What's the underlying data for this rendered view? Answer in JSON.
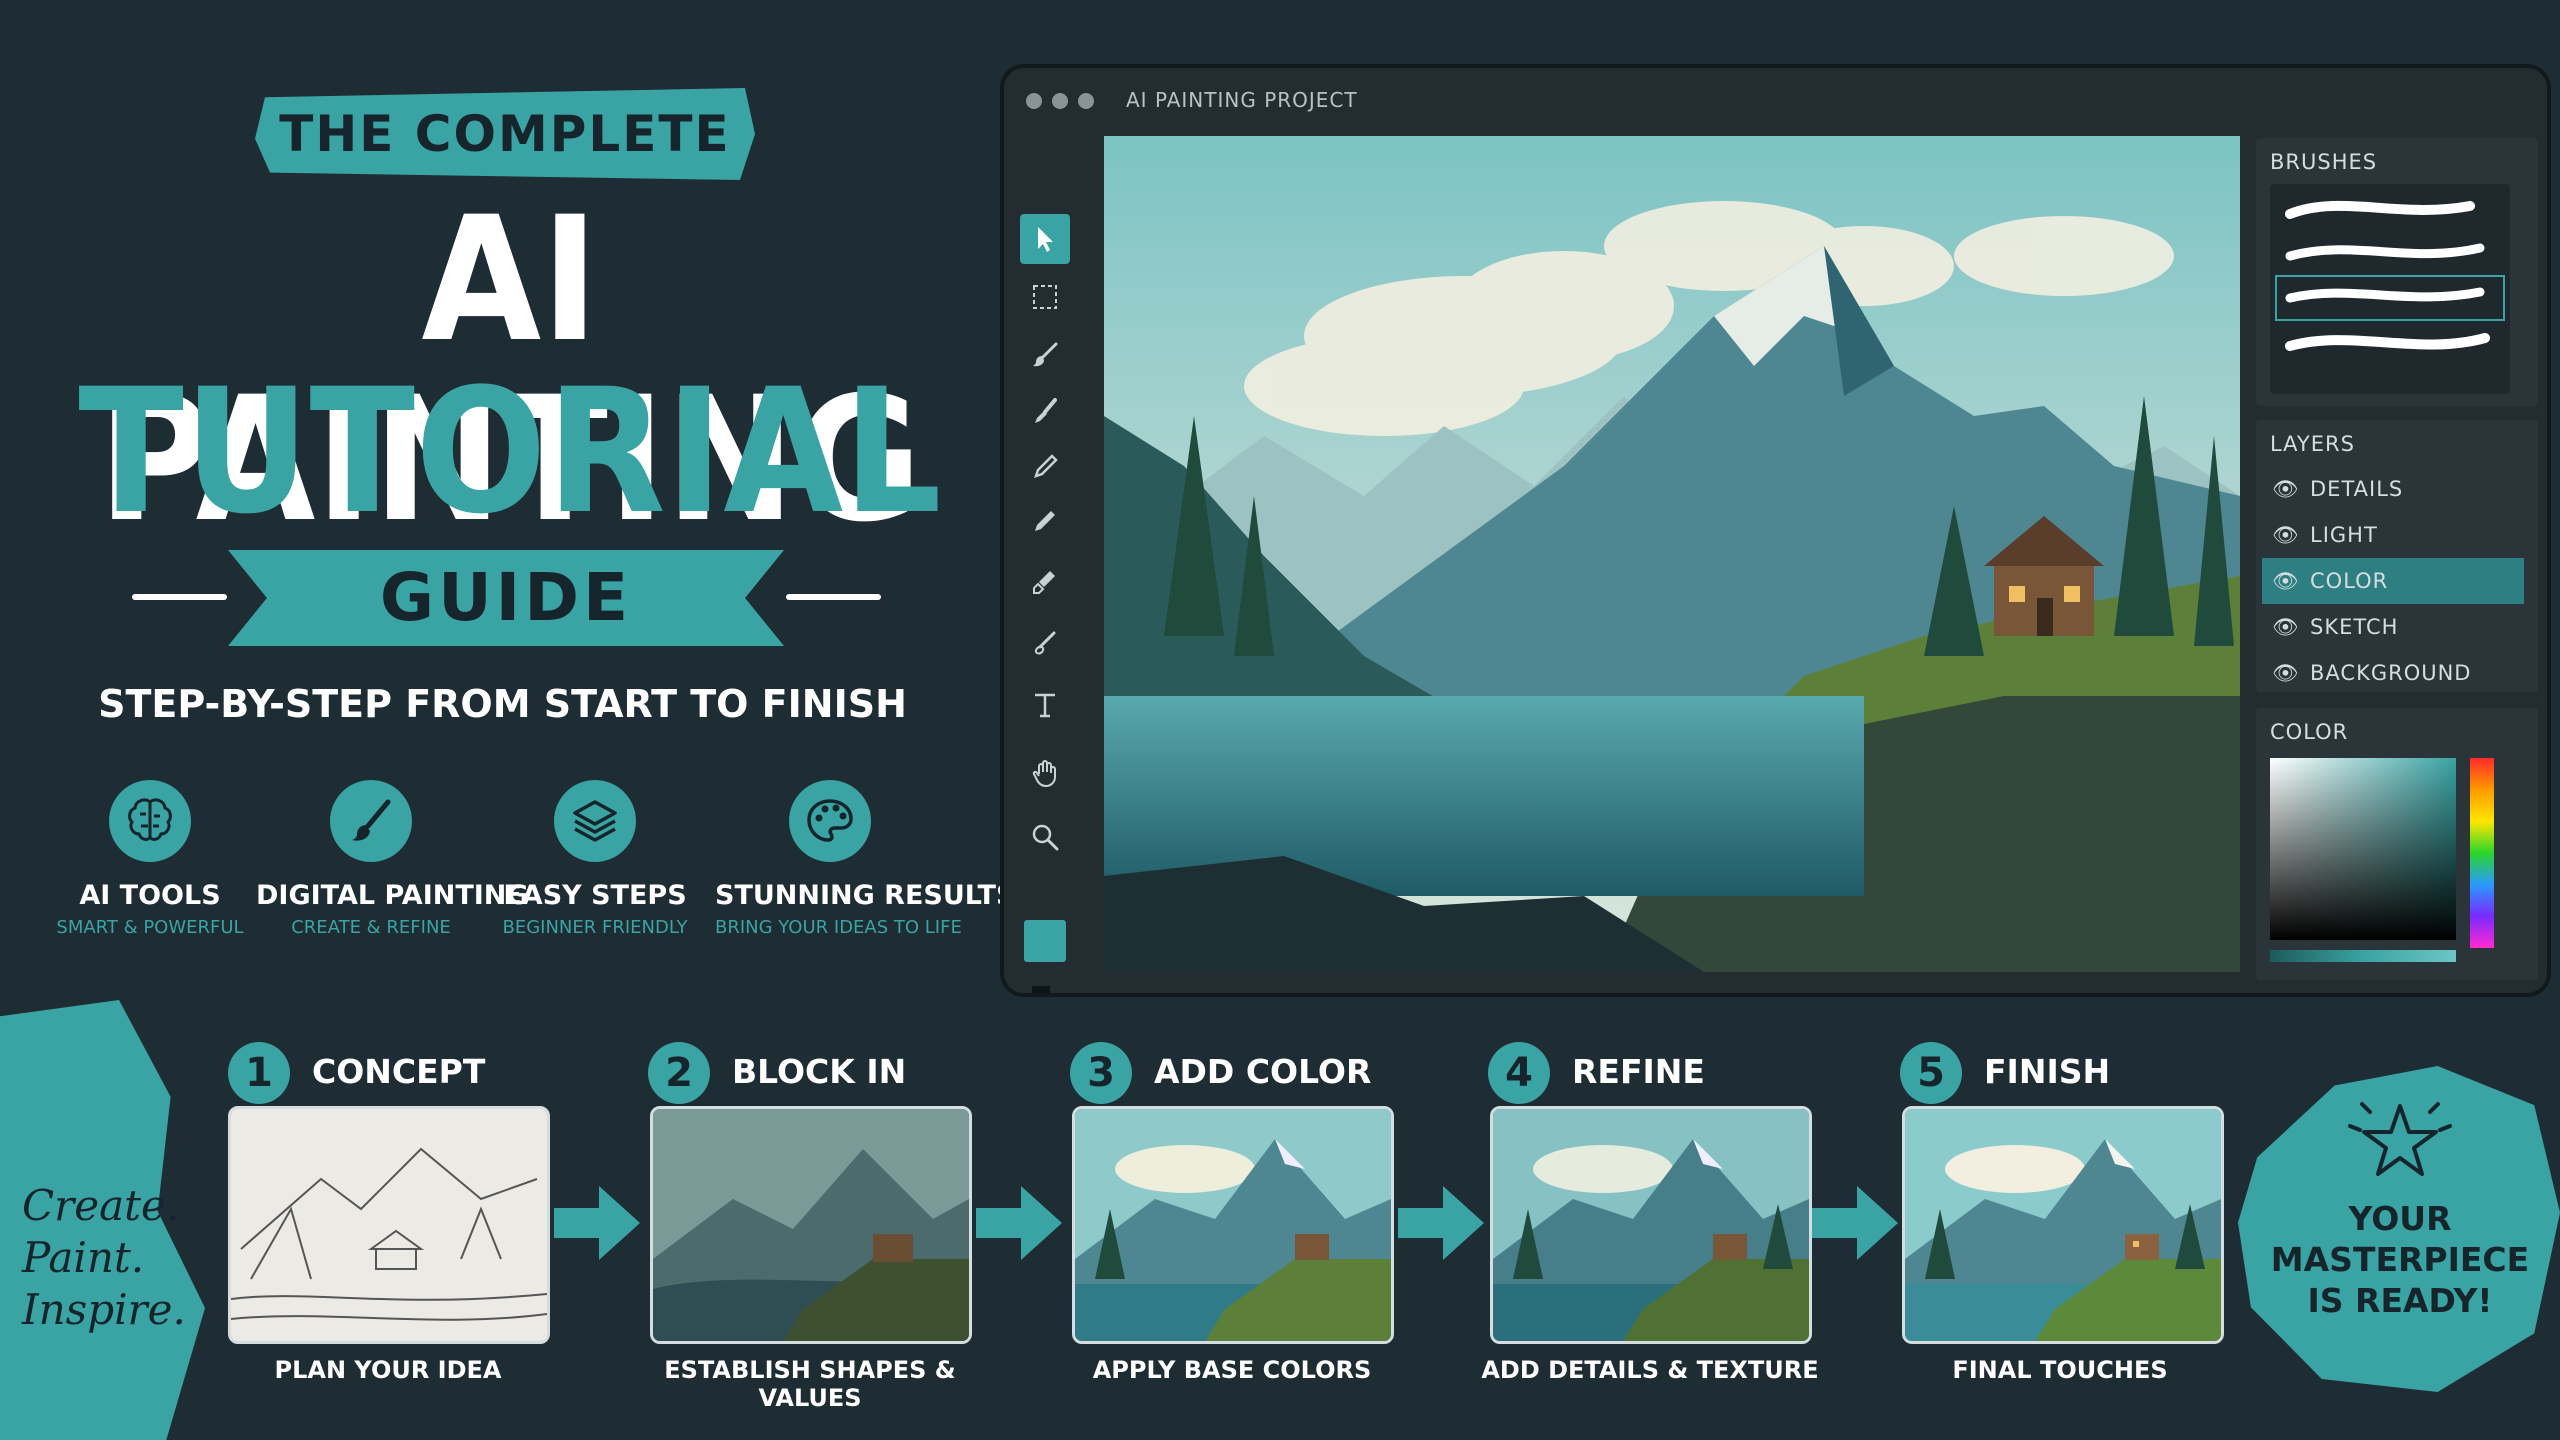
{
  "hero": {
    "top_ribbon": "THE COMPLETE",
    "title_line1": "AI PAINTING",
    "title_line2": "TUTORIAL",
    "guide": "GUIDE",
    "subtitle": "STEP-BY-STEP FROM START TO FINISH"
  },
  "features": [
    {
      "name": "AI TOOLS",
      "desc": "SMART & POWERFUL",
      "icon": "brain-icon"
    },
    {
      "name": "DIGITAL PAINTING",
      "desc": "CREATE & REFINE",
      "icon": "brush-icon"
    },
    {
      "name": "EASY STEPS",
      "desc": "BEGINNER FRIENDLY",
      "icon": "layers-icon"
    },
    {
      "name": "STUNNING RESULTS",
      "desc": "BRING YOUR IDEAS TO LIFE",
      "icon": "palette-icon"
    }
  ],
  "window": {
    "title": "AI PAINTING PROJECT",
    "tools": [
      "select-arrow-icon",
      "marquee-select-icon",
      "brush-icon",
      "paintbrush-icon",
      "pen-icon",
      "pencil-icon",
      "eraser-icon",
      "smudge-icon",
      "text-tool-icon",
      "hand-icon",
      "zoom-icon"
    ],
    "active_tool": "select-arrow-icon",
    "primary_color": "#3aa3a3"
  },
  "panel": {
    "brushes_title": "BRUSHES",
    "layers_title": "LAYERS",
    "layers": [
      "DETAILS",
      "LIGHT",
      "COLOR",
      "SKETCH",
      "BACKGROUND"
    ],
    "selected_layer": "COLOR",
    "color_title": "COLOR"
  },
  "steps": [
    {
      "num": "1",
      "label": "CONCEPT",
      "caption": "PLAN YOUR IDEA"
    },
    {
      "num": "2",
      "label": "BLOCK IN",
      "caption": "ESTABLISH SHAPES & VALUES"
    },
    {
      "num": "3",
      "label": "ADD COLOR",
      "caption": "APPLY BASE COLORS"
    },
    {
      "num": "4",
      "label": "REFINE",
      "caption": "ADD DETAILS & TEXTURE"
    },
    {
      "num": "5",
      "label": "FINISH",
      "caption": "FINAL TOUCHES"
    }
  ],
  "slogan": [
    "Create.",
    "Paint.",
    "Inspire."
  ],
  "masterpiece": [
    "YOUR",
    "MASTERPIECE",
    "IS READY!"
  ],
  "colors": {
    "accent": "#3aa3a3",
    "background": "#1e2c33",
    "dark_text": "#15252b"
  }
}
